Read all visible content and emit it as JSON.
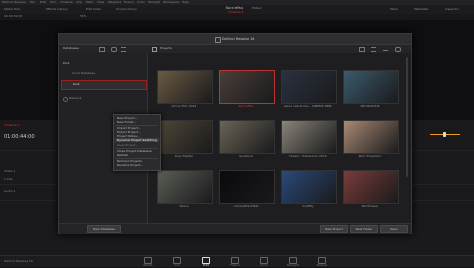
{
  "menubar": {
    "items": [
      "DaVinci Resolve",
      "File",
      "Edit",
      "Trim",
      "Timeline",
      "Clip",
      "Mark",
      "View",
      "Playback",
      "Fusion",
      "Color",
      "Fairlight",
      "Workspace",
      "Help"
    ]
  },
  "toolbar": {
    "project_title": "Kurz elfhu",
    "edited_label": "Edited",
    "timeline_name": "Timeline 1",
    "left_items": [
      "Media Pool",
      "Effects Library",
      "Edit Index",
      "Sound Library"
    ],
    "right_items": [
      "Mixer",
      "Metadata",
      "Inspector"
    ],
    "timecode": "00:00:32:15",
    "zoom": "55%"
  },
  "timeline": {
    "name": "Timeline 1",
    "timecode": "01:00:44:00",
    "track_labels": [
      "Video 1",
      "Audio 1"
    ],
    "clip_count_label": "1 Clip"
  },
  "dialog": {
    "title": "DaVinci Resolve 16",
    "databases_label": "Databases",
    "projects_label": "Projects",
    "db_group": "Disk",
    "db_items": [
      "Local Database",
      "Kurz"
    ],
    "network_label": "Network",
    "new_database_label": "New Database",
    "new_project_label": "New Project",
    "new_folder_label": "New Folder",
    "open_label": "Open",
    "projects": [
      {
        "name": "Drone Film 2019",
        "color": "#6a5a44"
      },
      {
        "name": "Kurz elfhu",
        "color": "#4a3e38",
        "selected": true
      },
      {
        "name": "elena cabral fue... CINEMA REEL",
        "color": "#2a3140"
      },
      {
        "name": "MM MASHUP",
        "color": "#3c5a6c"
      },
      {
        "name": "Dojo Fighter",
        "color": "#4f4636"
      },
      {
        "name": "Sunshine",
        "color": "#6a6456"
      },
      {
        "name": "Dream - Pressroom 2019",
        "color": "#8a8478"
      },
      {
        "name": "Rohr Projektion",
        "color": "#a88a74"
      },
      {
        "name": "Wolve",
        "color": "#5a5e56"
      },
      {
        "name": "cameraTrackTest",
        "color": "#0a0a0c"
      },
      {
        "name": "Graffity",
        "color": "#2a4a7a"
      },
      {
        "name": "Wirthmaier",
        "color": "#7a3c3a"
      }
    ],
    "context_menu": [
      "New Project...",
      "New Folder...",
      "Import Project...",
      "Export Project...",
      "Project Notes...",
      "Dynamic Project Switching",
      "Save Project...",
      "Close Project Database",
      "Refresh",
      "Remove Projects",
      "Rename Project..."
    ],
    "context_highlight_index": 5
  },
  "pages": [
    {
      "label": "Media"
    },
    {
      "label": "Cut"
    },
    {
      "label": "Edit",
      "active": true
    },
    {
      "label": "Fusion"
    },
    {
      "label": "Color"
    },
    {
      "label": "Fairlight"
    },
    {
      "label": "Deliver"
    }
  ],
  "app_footer": "DaVinci Resolve 16"
}
